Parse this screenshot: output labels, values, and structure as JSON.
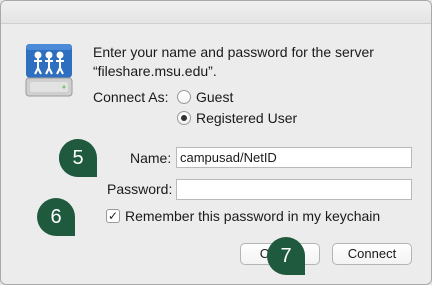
{
  "dialog": {
    "message_line1": "Enter your name and password for the server",
    "message_line2": "“fileshare.msu.edu”.",
    "connect_as_label": "Connect As:",
    "guest_label": "Guest",
    "registered_label": "Registered User",
    "connect_as_selected": "Registered User",
    "name_label": "Name:",
    "name_value": "campusad/NetID",
    "password_label": "Password:",
    "password_value": "",
    "remember_label": "Remember this password in my keychain",
    "remember_checked": true,
    "cancel_label": "Cancel",
    "connect_label": "Connect"
  },
  "callouts": [
    "5",
    "6",
    "7"
  ],
  "colors": {
    "callout": "#1f5a3e",
    "dialog_bg": "#ececec",
    "icon_blue": "#2f6fbf"
  },
  "icons": {
    "server": "server-icon",
    "checkmark": "checkmark-icon"
  }
}
